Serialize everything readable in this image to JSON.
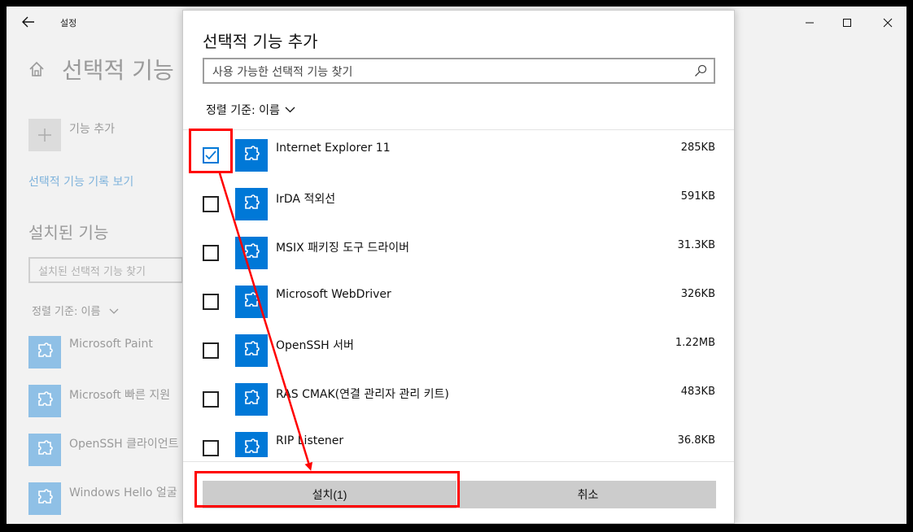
{
  "window": {
    "title": "설정"
  },
  "background": {
    "page_title": "선택적 기능",
    "add_feature": "기능 추가",
    "history_link": "선택적 기능 기록 보기",
    "installed_heading": "설치된 기능",
    "installed_search_placeholder": "설치된 선택적 기능 찾기",
    "sort_label": "정렬 기준: 이름",
    "installed_items": [
      {
        "label": "Microsoft Paint"
      },
      {
        "label": "Microsoft 빠른 지원"
      },
      {
        "label": "OpenSSH 클라이언트"
      },
      {
        "label": "Windows Hello 얼굴"
      }
    ]
  },
  "dialog": {
    "title": "선택적 기능 추가",
    "search_placeholder": "사용 가능한 선택적 기능 찾기",
    "sort_label": "정렬 기준: 이름",
    "features": [
      {
        "name": "Internet Explorer 11",
        "size": "285KB",
        "checked": true
      },
      {
        "name": "IrDA 적외선",
        "size": "591KB",
        "checked": false
      },
      {
        "name": "MSIX 패키징 도구 드라이버",
        "size": "31.3KB",
        "checked": false
      },
      {
        "name": "Microsoft WebDriver",
        "size": "326KB",
        "checked": false
      },
      {
        "name": "OpenSSH 서버",
        "size": "1.22MB",
        "checked": false
      },
      {
        "name": "RAS CMAK(연결 관리자 관리 키트)",
        "size": "483KB",
        "checked": false
      },
      {
        "name": "RIP Listener",
        "size": "36.8KB",
        "checked": false
      }
    ],
    "install_button": "설치(1)",
    "cancel_button": "취소"
  },
  "colors": {
    "accent": "#0078d7",
    "annotation": "#ff0000"
  },
  "icons": {
    "back": "back-arrow-icon",
    "home": "home-icon",
    "search": "search-icon",
    "feature": "puzzle-piece-icon"
  }
}
